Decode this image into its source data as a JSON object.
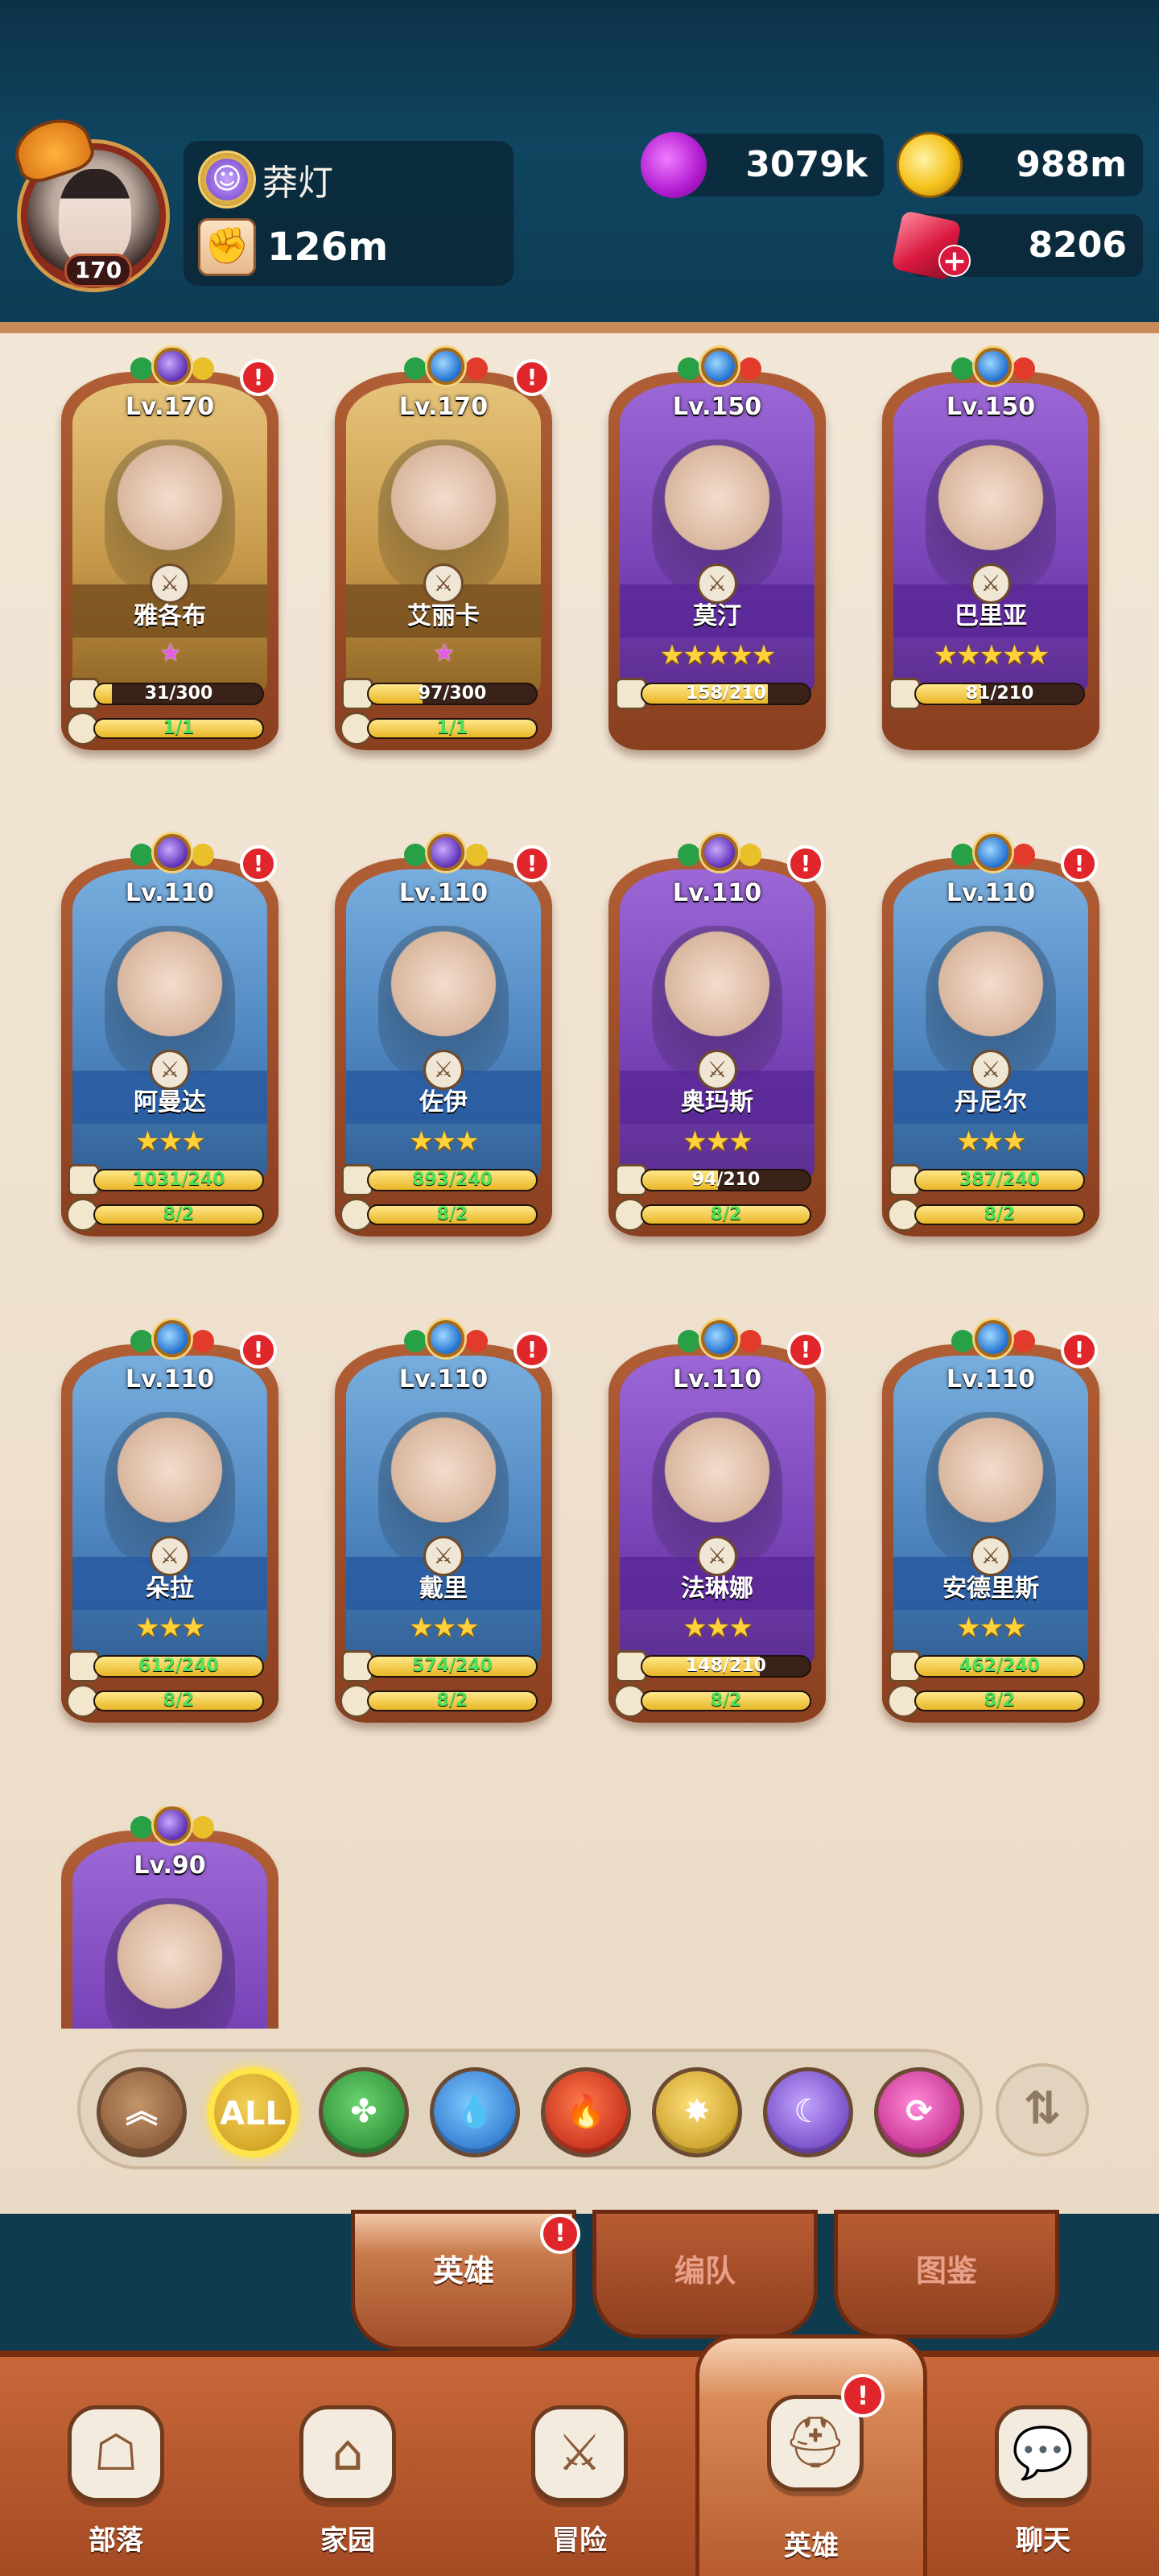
{
  "player": {
    "level": "170",
    "name": "莽灯",
    "power": "126m"
  },
  "resources": {
    "potion": "3079k",
    "gold": "988m",
    "gems": "8206",
    "gems_plus": "+"
  },
  "heroes": [
    {
      "level": "Lv.170",
      "name": "雅各布",
      "shards": "31/300",
      "copies": "1/1",
      "rarity": "gold",
      "stars": "★",
      "star_style": "pink",
      "element": "moon",
      "shard_frac": 0.1,
      "copy_frac": 1.0,
      "shard_green": false,
      "alert": true
    },
    {
      "level": "Lv.170",
      "name": "艾丽卡",
      "shards": "97/300",
      "copies": "1/1",
      "rarity": "gold",
      "stars": "★",
      "star_style": "pink",
      "element": "water",
      "shard_frac": 0.32,
      "copy_frac": 1.0,
      "shard_green": false,
      "alert": true
    },
    {
      "level": "Lv.150",
      "name": "莫汀",
      "shards": "158/210",
      "copies": "",
      "rarity": "purple",
      "stars": "★★★★★",
      "star_style": "gold",
      "element": "water",
      "shard_frac": 0.75,
      "copy_frac": 0,
      "shard_green": false,
      "alert": false
    },
    {
      "level": "Lv.150",
      "name": "巴里亚",
      "shards": "81/210",
      "copies": "",
      "rarity": "purple",
      "stars": "★★★★★",
      "star_style": "gold",
      "element": "water",
      "shard_frac": 0.39,
      "copy_frac": 0,
      "shard_green": false,
      "alert": false
    },
    {
      "level": "Lv.110",
      "name": "阿曼达",
      "shards": "1031/240",
      "copies": "8/2",
      "rarity": "blue",
      "stars": "★★★",
      "star_style": "gold",
      "element": "moon",
      "shard_frac": 1.0,
      "copy_frac": 1.0,
      "shard_green": true,
      "alert": true
    },
    {
      "level": "Lv.110",
      "name": "佐伊",
      "shards": "893/240",
      "copies": "8/2",
      "rarity": "blue",
      "stars": "★★★",
      "star_style": "gold",
      "element": "moon",
      "shard_frac": 1.0,
      "copy_frac": 1.0,
      "shard_green": true,
      "alert": true
    },
    {
      "level": "Lv.110",
      "name": "奥玛斯",
      "shards": "94/210",
      "copies": "8/2",
      "rarity": "purple",
      "stars": "★★★",
      "star_style": "gold",
      "element": "moon",
      "shard_frac": 0.45,
      "copy_frac": 1.0,
      "shard_green": false,
      "alert": true
    },
    {
      "level": "Lv.110",
      "name": "丹尼尔",
      "shards": "387/240",
      "copies": "8/2",
      "rarity": "blue",
      "stars": "★★★",
      "star_style": "gold",
      "element": "water",
      "shard_frac": 1.0,
      "copy_frac": 1.0,
      "shard_green": true,
      "alert": true
    },
    {
      "level": "Lv.110",
      "name": "朵拉",
      "shards": "612/240",
      "copies": "8/2",
      "rarity": "blue",
      "stars": "★★★",
      "star_style": "gold",
      "element": "water",
      "shard_frac": 1.0,
      "copy_frac": 1.0,
      "shard_green": true,
      "alert": true
    },
    {
      "level": "Lv.110",
      "name": "戴里",
      "shards": "574/240",
      "copies": "8/2",
      "rarity": "blue",
      "stars": "★★★",
      "star_style": "gold",
      "element": "water",
      "shard_frac": 1.0,
      "copy_frac": 1.0,
      "shard_green": true,
      "alert": true
    },
    {
      "level": "Lv.110",
      "name": "法琳娜",
      "shards": "148/210",
      "copies": "8/2",
      "rarity": "purple",
      "stars": "★★★",
      "star_style": "gold",
      "element": "water",
      "shard_frac": 0.7,
      "copy_frac": 1.0,
      "shard_green": false,
      "alert": true
    },
    {
      "level": "Lv.110",
      "name": "安德里斯",
      "shards": "462/240",
      "copies": "8/2",
      "rarity": "blue",
      "stars": "★★★",
      "star_style": "gold",
      "element": "water",
      "shard_frac": 1.0,
      "copy_frac": 1.0,
      "shard_green": true,
      "alert": true
    },
    {
      "level": "Lv.90",
      "name": "",
      "shards": "",
      "copies": "",
      "rarity": "purple",
      "stars": "",
      "star_style": "gold",
      "element": "moon",
      "shard_frac": 0,
      "copy_frac": 0,
      "shard_green": false,
      "alert": false
    }
  ],
  "filters": {
    "all_label": "ALL",
    "selected": "all"
  },
  "subtabs": {
    "heroes": "英雄",
    "team": "编队",
    "codex": "图鉴",
    "alert": "!"
  },
  "nav": {
    "tribe": "部落",
    "home": "家园",
    "adventure": "冒险",
    "heroes": "英雄",
    "chat": "聊天",
    "alert": "!"
  },
  "colors": {
    "header_bg": "#0f4560",
    "parchment": "#f2e6d6",
    "accent_orange": "#c8673a",
    "alert_red": "#e0262b",
    "shard_green_text": "#4ce25a"
  }
}
